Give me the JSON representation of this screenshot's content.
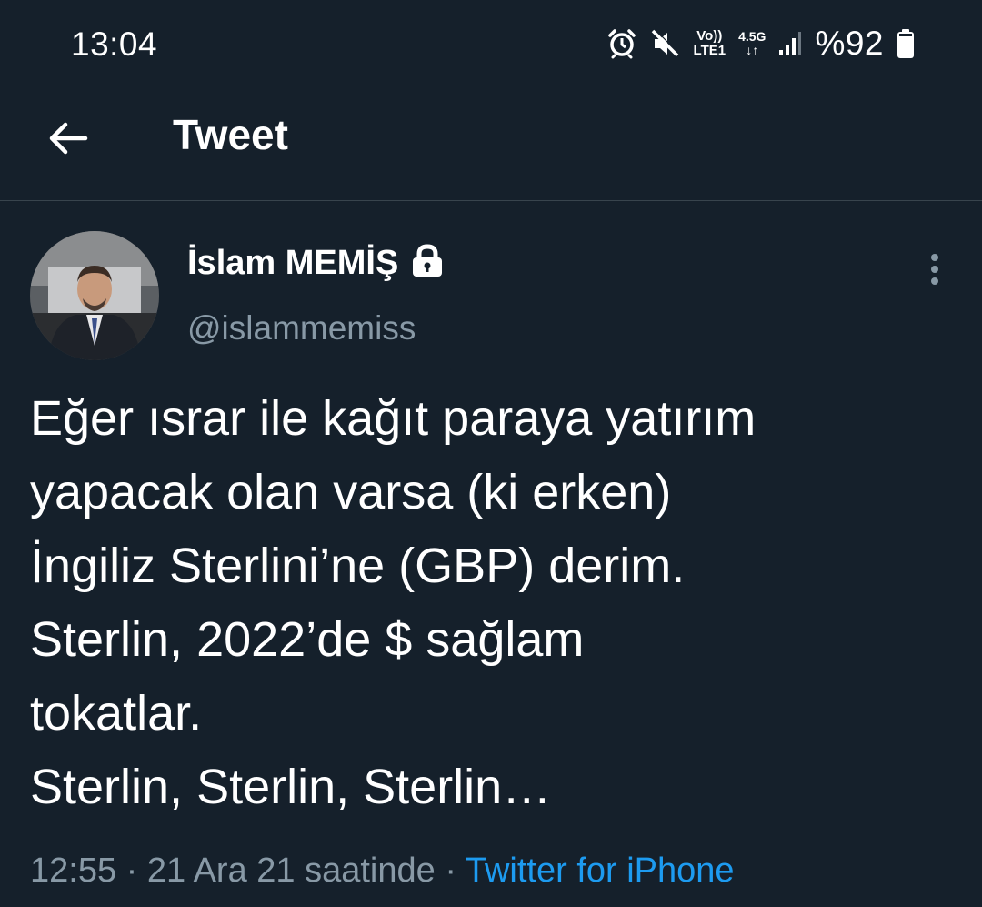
{
  "status_bar": {
    "time": "13:04",
    "volte_top": "Vo))",
    "volte_bottom": "LTE1",
    "network_top": "4.5G",
    "network_bottom": "↓↑",
    "battery": "%92",
    "icons": [
      "alarm-icon",
      "mute-icon",
      "volte-icon",
      "network-4-5g-icon",
      "signal-icon",
      "battery-icon"
    ]
  },
  "header": {
    "title": "Tweet",
    "back_icon": "arrow-left-icon"
  },
  "tweet": {
    "author_name": "İslam MEMİŞ",
    "author_handle": "@islammemiss",
    "protected_icon": "lock-icon",
    "more_icon": "more-vertical-icon",
    "text_lines": [
      "Eğer ısrar ile kağıt paraya yatırım",
      "yapacak olan varsa (ki erken)",
      "İngiliz Sterlini’ne (GBP) derim.",
      "Sterlin, 2022’de $ sağlam",
      "tokatlar.",
      "Sterlin, Sterlin, Sterlin…"
    ],
    "meta_time": "12:55 · 21 Ara 21 saatinde · ",
    "meta_source": "Twitter for iPhone"
  },
  "colors": {
    "background": "#15202b",
    "text_primary": "#ffffff",
    "text_secondary": "#8899a6",
    "accent": "#1d9bf0",
    "divider": "#38444d"
  }
}
